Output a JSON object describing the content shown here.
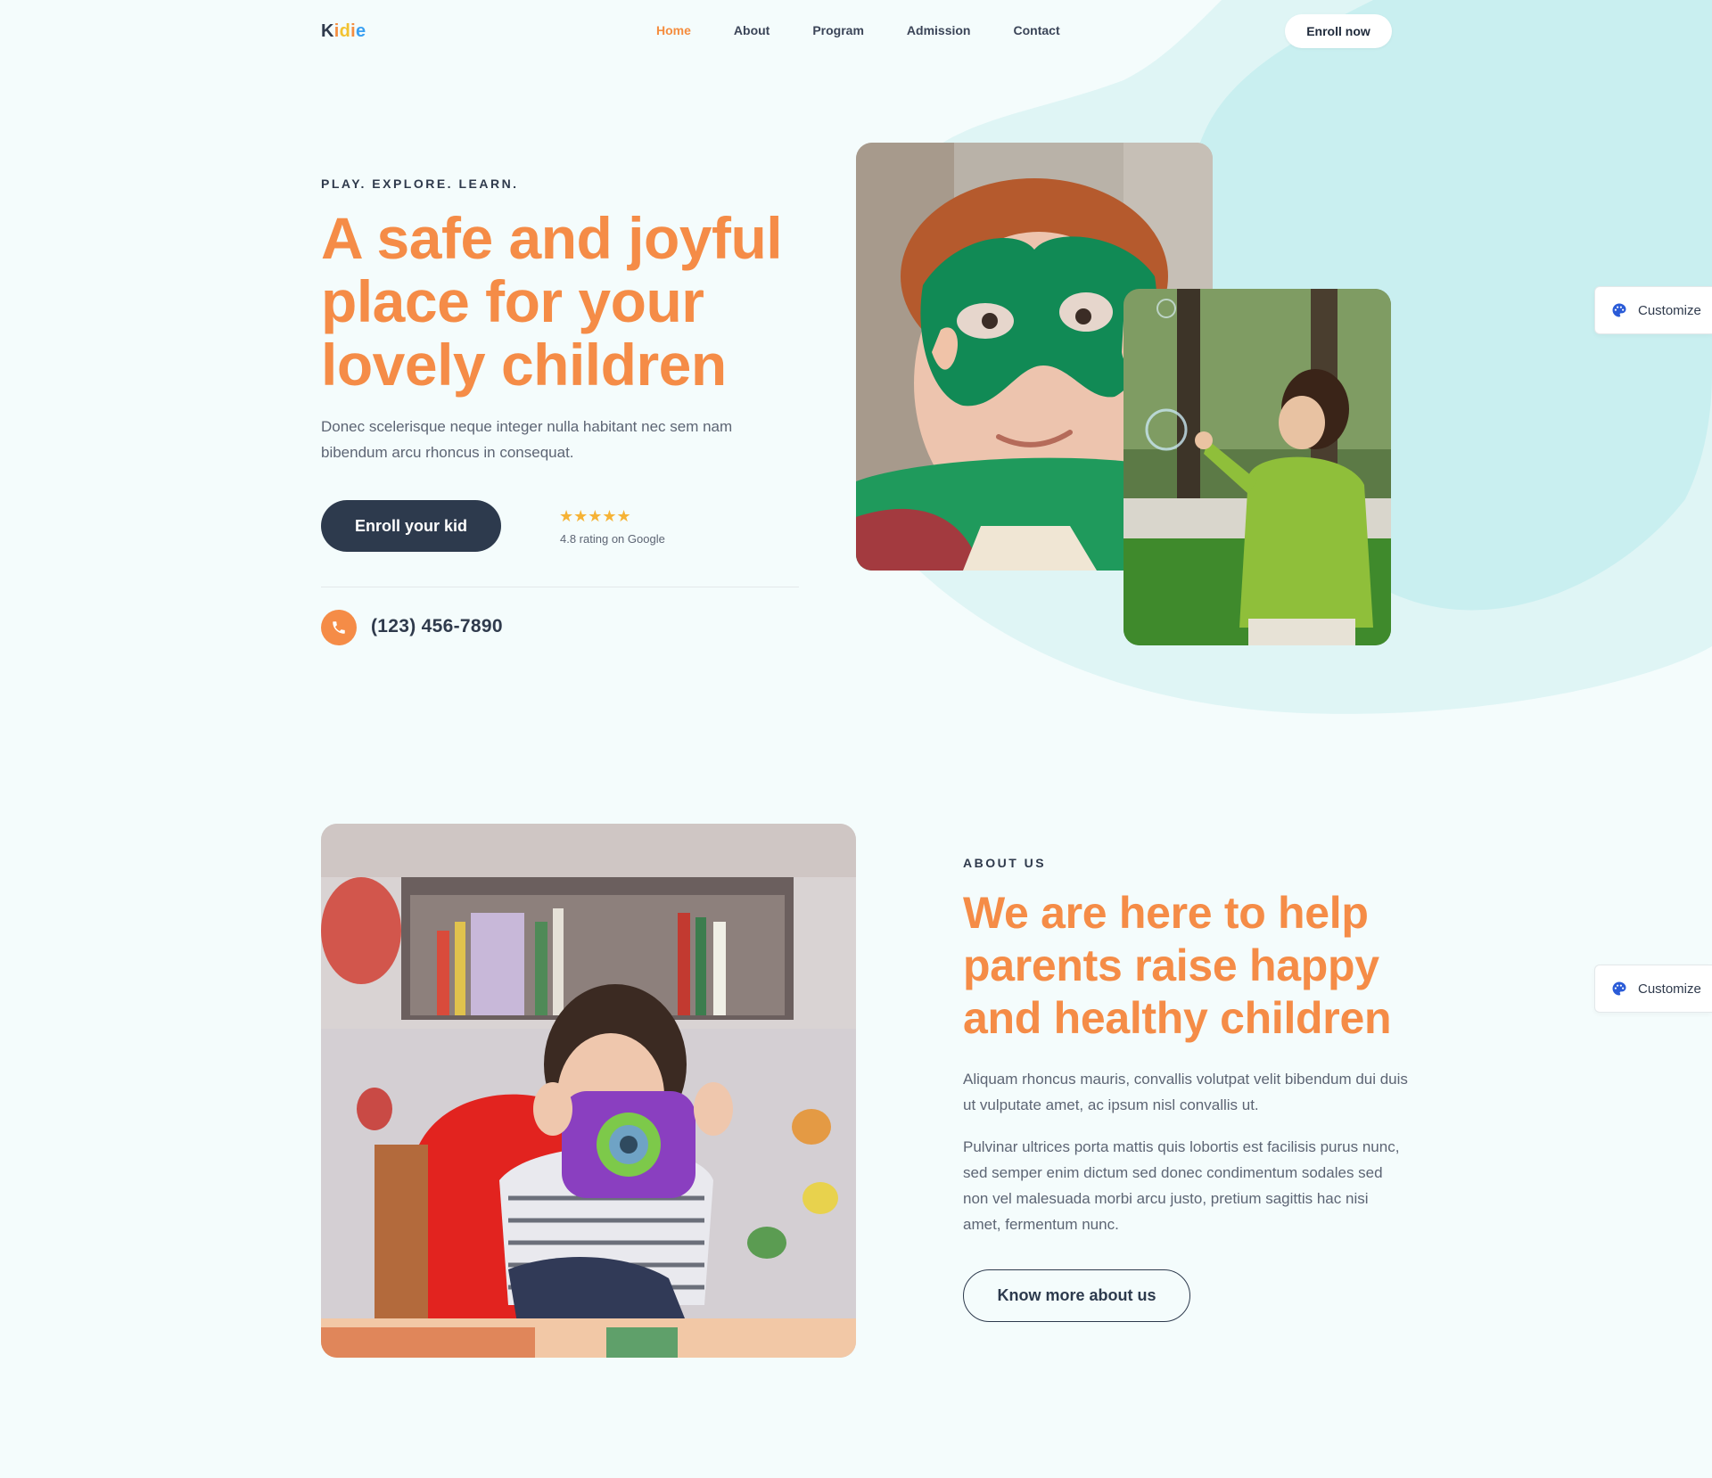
{
  "brand": {
    "logo": "Kidie",
    "primary": "#f58c47",
    "dark": "#2d3a4d",
    "background": "#f4fcfc",
    "blob": "#cdf0f1"
  },
  "nav": {
    "items": [
      {
        "label": "Home",
        "active": true
      },
      {
        "label": "About",
        "active": false
      },
      {
        "label": "Program",
        "active": false
      },
      {
        "label": "Admission",
        "active": false
      },
      {
        "label": "Contact",
        "active": false
      }
    ],
    "cta": "Enroll now"
  },
  "hero": {
    "eyebrow": "PLAY. EXPLORE. LEARN.",
    "title": "A safe and joyful place for your lovely children",
    "description": "Donec scelerisque neque integer nulla habitant nec sem nam bibendum arcu rhoncus in consequat.",
    "button": "Enroll your kid",
    "stars": "★★★★★",
    "rating_value": 5,
    "rating_text": "4.8 rating on Google",
    "phone": "(123) 456-7890",
    "phone_icon": "phone-icon",
    "images": [
      "boy-with-green-mask-photo",
      "girl-catching-bubbles-photo"
    ]
  },
  "customize": {
    "label": "Customize",
    "icon": "palette-icon"
  },
  "about": {
    "eyebrow": "ABOUT US",
    "title": "We are here to help parents raise happy and healthy children",
    "paragraph1": "Aliquam rhoncus mauris, convallis volutpat velit bibendum dui duis ut vulputate amet, ac ipsum nisl convallis ut.",
    "paragraph2": "Pulvinar ultrices porta mattis quis lobortis est facilisis purus nunc, sed semper enim dictum sed donec condimentum sodales sed non vel malesuada morbi arcu justo, pretium sagittis hac nisi amet, fermentum nunc.",
    "button": "Know more about us",
    "image": "girl-with-toy-camera-photo"
  }
}
